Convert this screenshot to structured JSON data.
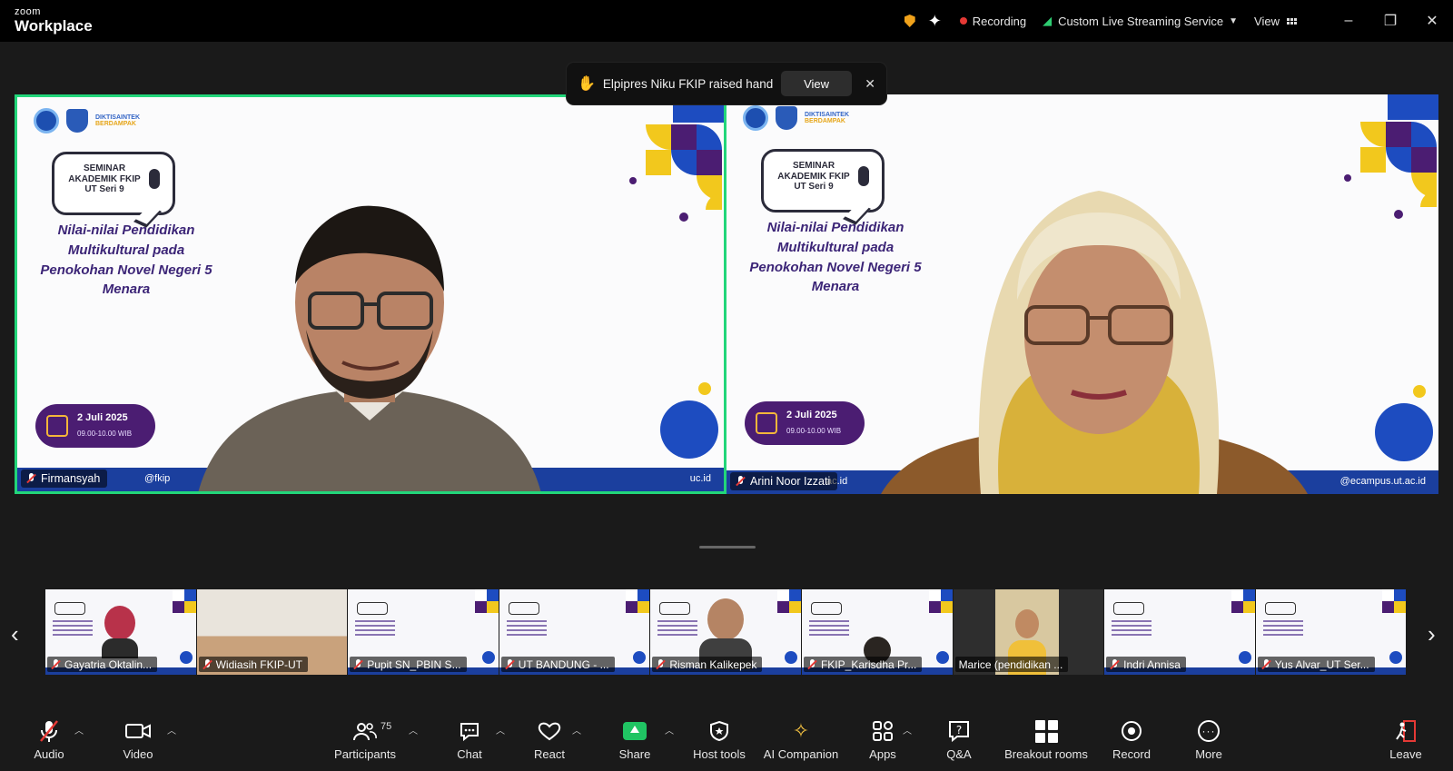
{
  "app": {
    "brand_small": "zoom",
    "brand_large": "Workplace"
  },
  "titlebar": {
    "recording_label": "Recording",
    "streaming_label": "Custom Live Streaming Service",
    "view_label": "View",
    "colors": {
      "shield": "#f0a21b",
      "recording_dot": "#e53935",
      "stream": "#2ecc71"
    }
  },
  "notification": {
    "text": "Elpipres Niku FKIP raised hand",
    "view_button": "View"
  },
  "main_tiles": [
    {
      "name": "Firmansyah",
      "active_speaker": true,
      "slide": {
        "brand_word1": "DIKTISAINTEK",
        "brand_word2": "BERDAMPAK",
        "bubble_text": "SEMINAR AKADEMIK FKIP UT Seri 9",
        "headline": "Nilai-nilai Pendidikan Multikultural pada Penokohan Novel Negeri 5 Menara",
        "date": "2 Juli 2025",
        "time": "09.00-10.00 WIB",
        "handle_left": "@fkip",
        "handle_right": "uc.id"
      }
    },
    {
      "name": "Arini Noor Izzati",
      "active_speaker": false,
      "slide": {
        "brand_word1": "DIKTISAINTEK",
        "brand_word2": "BERDAMPAK",
        "bubble_text": "SEMINAR AKADEMIK FKIP UT Seri 9",
        "headline": "Nilai-nilai Pendidikan Multikultural pada Penokohan Novel Negeri 5 Menara",
        "date": "2 Juli 2025",
        "time": "09.00-10.00 WIB",
        "handle_left": "ac.id",
        "handle_right": "@ecampus.ut.ac.id"
      }
    }
  ],
  "gallery": [
    {
      "name": "Gayatria Oktalin...",
      "muted": true
    },
    {
      "name": "Widiasih FKIP-UT",
      "muted": true
    },
    {
      "name": "Pupit SN_PBIN S...",
      "muted": true
    },
    {
      "name": "UT BANDUNG - ...",
      "muted": true
    },
    {
      "name": "Risman Kalikepek",
      "muted": true
    },
    {
      "name": "FKIP_Karisdha Pr...",
      "muted": true
    },
    {
      "name": "Marice (pendidikan ...",
      "muted": false
    },
    {
      "name": "Indri Annisa",
      "muted": true
    },
    {
      "name": "Yus Alvar_UT Ser...",
      "muted": true
    }
  ],
  "toolbar": {
    "audio": "Audio",
    "video": "Video",
    "participants": "Participants",
    "participants_count": "75",
    "chat": "Chat",
    "react": "React",
    "share": "Share",
    "host_tools": "Host tools",
    "ai_companion": "AI Companion",
    "apps": "Apps",
    "qa": "Q&A",
    "breakout": "Breakout rooms",
    "record": "Record",
    "more": "More",
    "leave": "Leave",
    "colors": {
      "share": "#20c463",
      "ai": "#f6c342",
      "leave": "#e53935"
    }
  },
  "colors": {
    "active_border": "#22d67a",
    "slide_purple": "#4b1d72",
    "slide_blue": "#1d4cc0",
    "slide_yellow": "#f2c81d"
  }
}
